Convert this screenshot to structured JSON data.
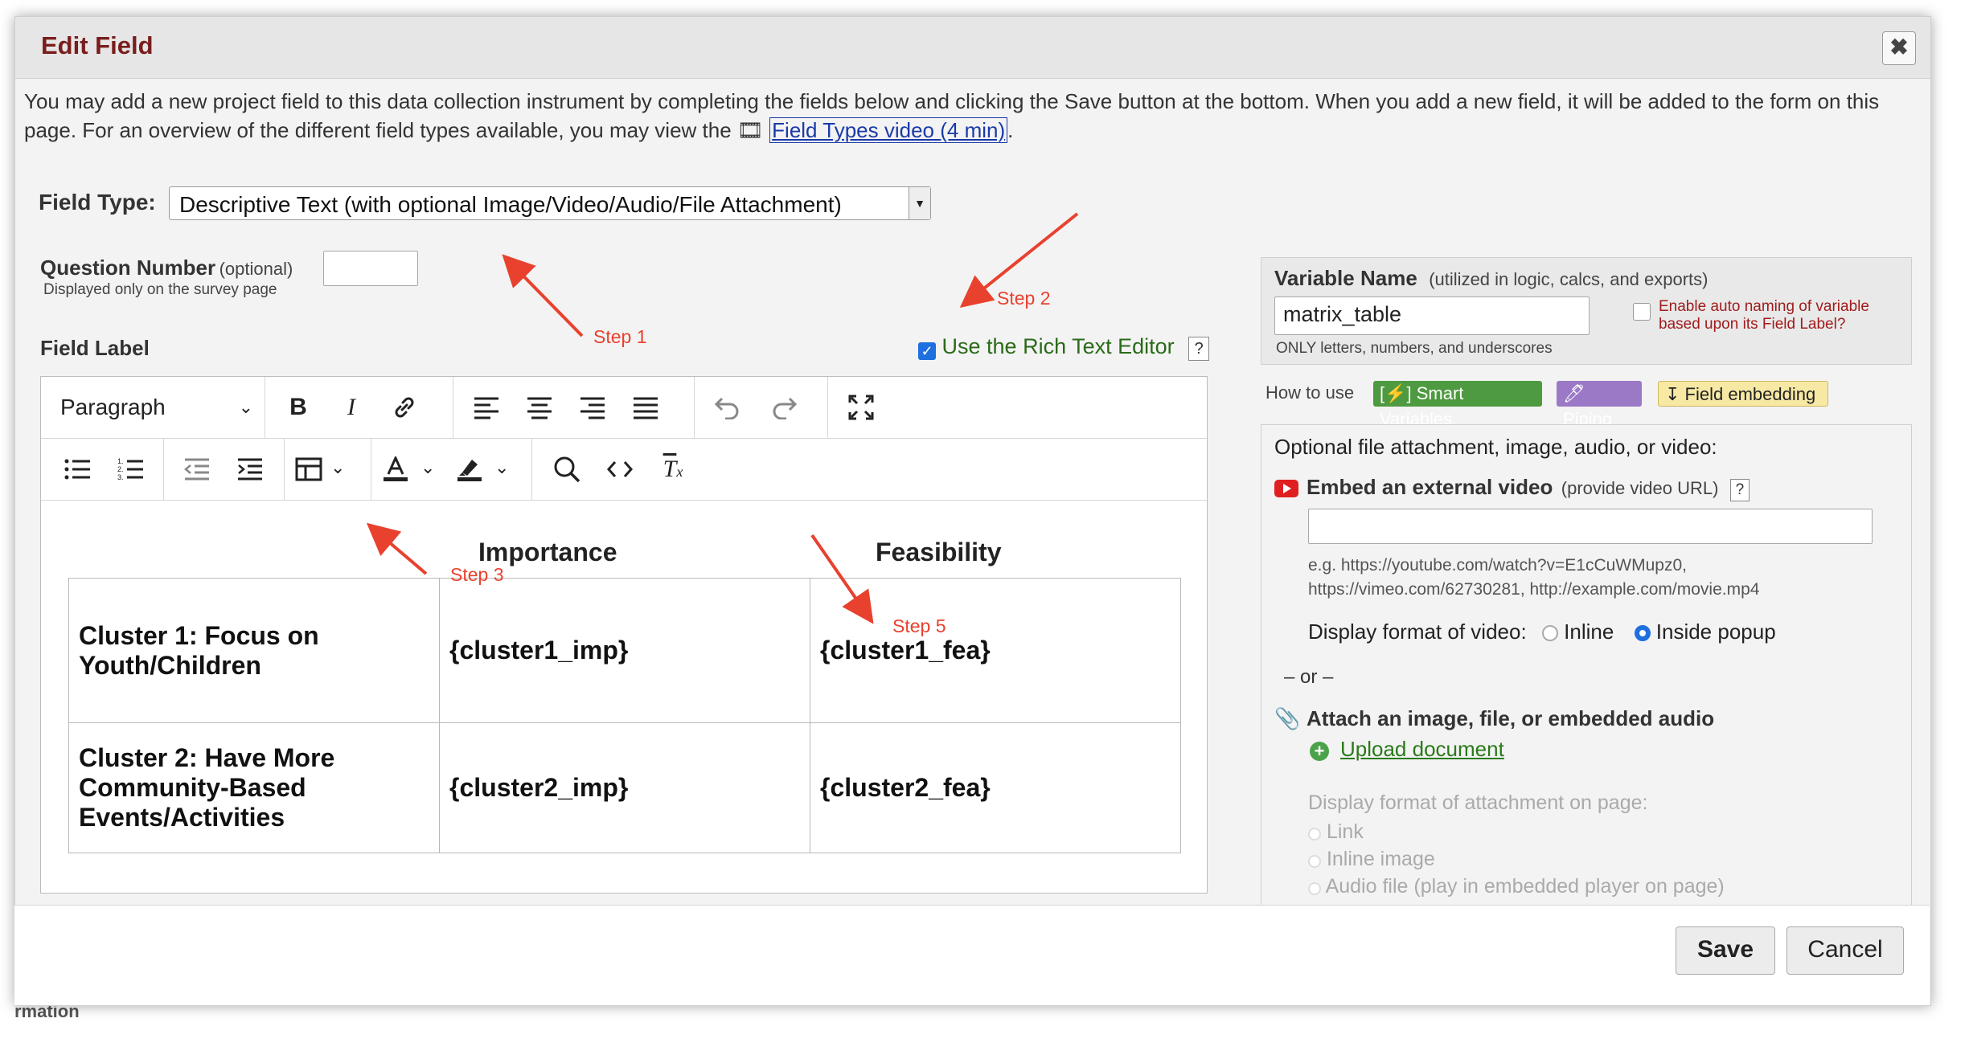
{
  "dialog": {
    "title": "Edit Field",
    "close_symbol": "✖"
  },
  "intro": {
    "text_before_link": "You may add a new project field to this data collection instrument by completing the fields below and clicking the Save button at the bottom. When you add a new field, it will be added to the form on this page. For an overview of the different field types available, you may view the",
    "video_icon": "🎞",
    "link_text": "Field Types video (4 min)",
    "text_after_link": "."
  },
  "field_type": {
    "label": "Field Type:",
    "value": "Descriptive Text (with optional Image/Video/Audio/File Attachment)",
    "arrow_icon": "▼"
  },
  "question_number": {
    "label": "Question Number",
    "optional": "(optional)",
    "hint": "Displayed only on the survey page",
    "value": ""
  },
  "field_label": {
    "label": "Field Label",
    "rich_text_label": "Use the Rich Text Editor",
    "rich_text_checked": true,
    "help": "?"
  },
  "editor": {
    "block_format": "Paragraph",
    "table_headers": [
      "Importance",
      "Feasibility"
    ],
    "rows": [
      {
        "cluster_bold": "Cluster 1:",
        "cluster_rest": " Focus on Youth/Children",
        "imp": "{cluster1_imp}",
        "fea": "{cluster1_fea}"
      },
      {
        "cluster_bold": "Cluster 2:",
        "cluster_rest": " Have More Community-Based Events/Activities",
        "imp": "{cluster2_imp}",
        "fea": "{cluster2_fea}"
      }
    ]
  },
  "steps": {
    "s1": "Step 1",
    "s2": "Step 2",
    "s3": "Step 3",
    "s5": "Step 5"
  },
  "variable": {
    "label": "Variable Name",
    "hint": "(utilized in logic, calcs, and exports)",
    "value": "matrix_table",
    "rule": "ONLY letters, numbers, and underscores",
    "auto_naming": "Enable auto naming of variable based upon its Field Label?"
  },
  "how_to_use": {
    "label": "How to use",
    "smart": "[⚡] Smart Variables",
    "piping": "🖊 Piping",
    "embedding": "↧ Field embedding"
  },
  "attachment": {
    "heading": "Optional file attachment, image, audio, or video:",
    "embed_title": "Embed an external video",
    "embed_hint": "(provide video URL)",
    "embed_help": "?",
    "url_value": "",
    "example": "e.g. https://youtube.com/watch?v=E1cCuWMupz0, https://vimeo.com/62730281, http://example.com/movie.mp4",
    "display_label": "Display format of video:",
    "inline": "Inline",
    "popup": "Inside popup",
    "or": "– or –",
    "attach_title": "Attach an image, file, or embedded audio",
    "upload": "Upload document",
    "display_attach": "Display format of attachment on page:",
    "opt_link": "Link",
    "opt_inline": "Inline image",
    "opt_audio": "Audio file (play in embedded player on page)"
  },
  "footer": {
    "save": "Save",
    "cancel": "Cancel"
  },
  "background_peek": "rmation"
}
